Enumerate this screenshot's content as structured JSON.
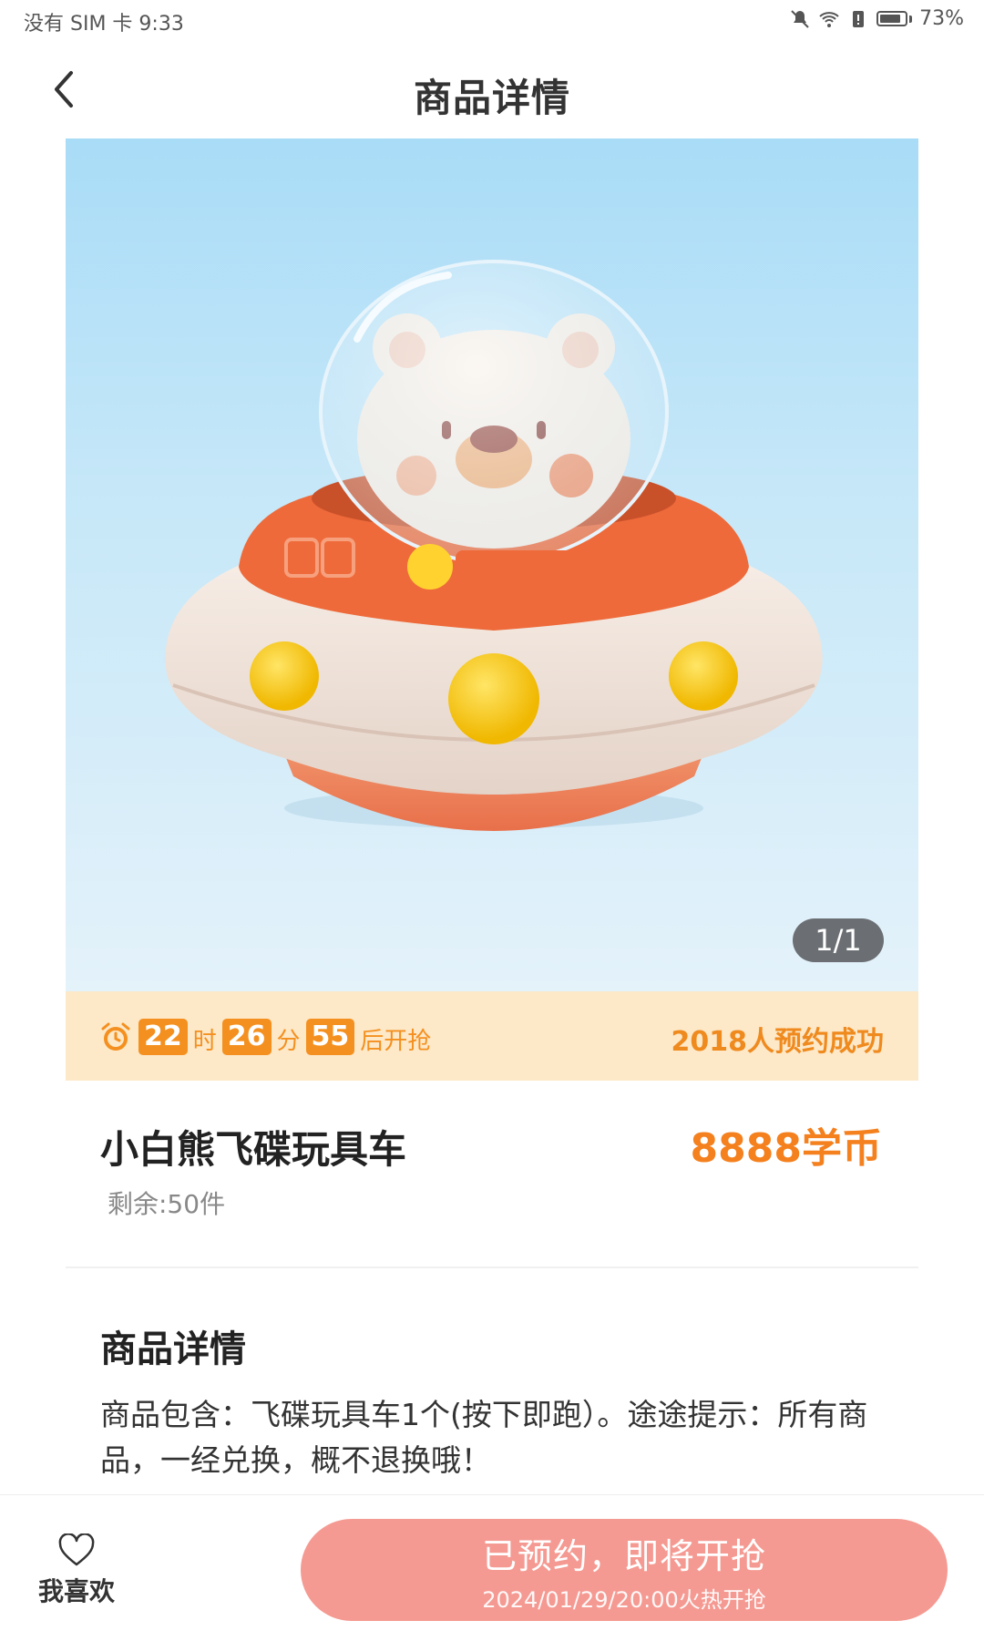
{
  "status": {
    "left": "没有 SIM 卡 9:33",
    "battery": "73%"
  },
  "nav": {
    "title": "商品详情"
  },
  "gallery": {
    "pager": "1/1"
  },
  "countdown": {
    "hours": "22",
    "hours_unit": "时",
    "minutes": "26",
    "minutes_unit": "分",
    "seconds": "55",
    "suffix": "后开抢",
    "reserved": "2018人预约成功"
  },
  "product": {
    "name": "小白熊飞碟玩具车",
    "price": "8888学币",
    "stock": "剩余:50件"
  },
  "details": {
    "title": "商品详情",
    "text": "商品包含：飞碟玩具车1个(按下即跑）。途途提示：所有商品，一经兑换，概不退换哦！"
  },
  "bottom": {
    "favorite_label": "我喜欢",
    "button_main": "已预约，即将开抢",
    "button_sub": "2024/01/29/20:00火热开抢"
  },
  "colors": {
    "accent": "#f4801e",
    "countdown_bg": "#fde8c8",
    "button": "#f59a92"
  }
}
